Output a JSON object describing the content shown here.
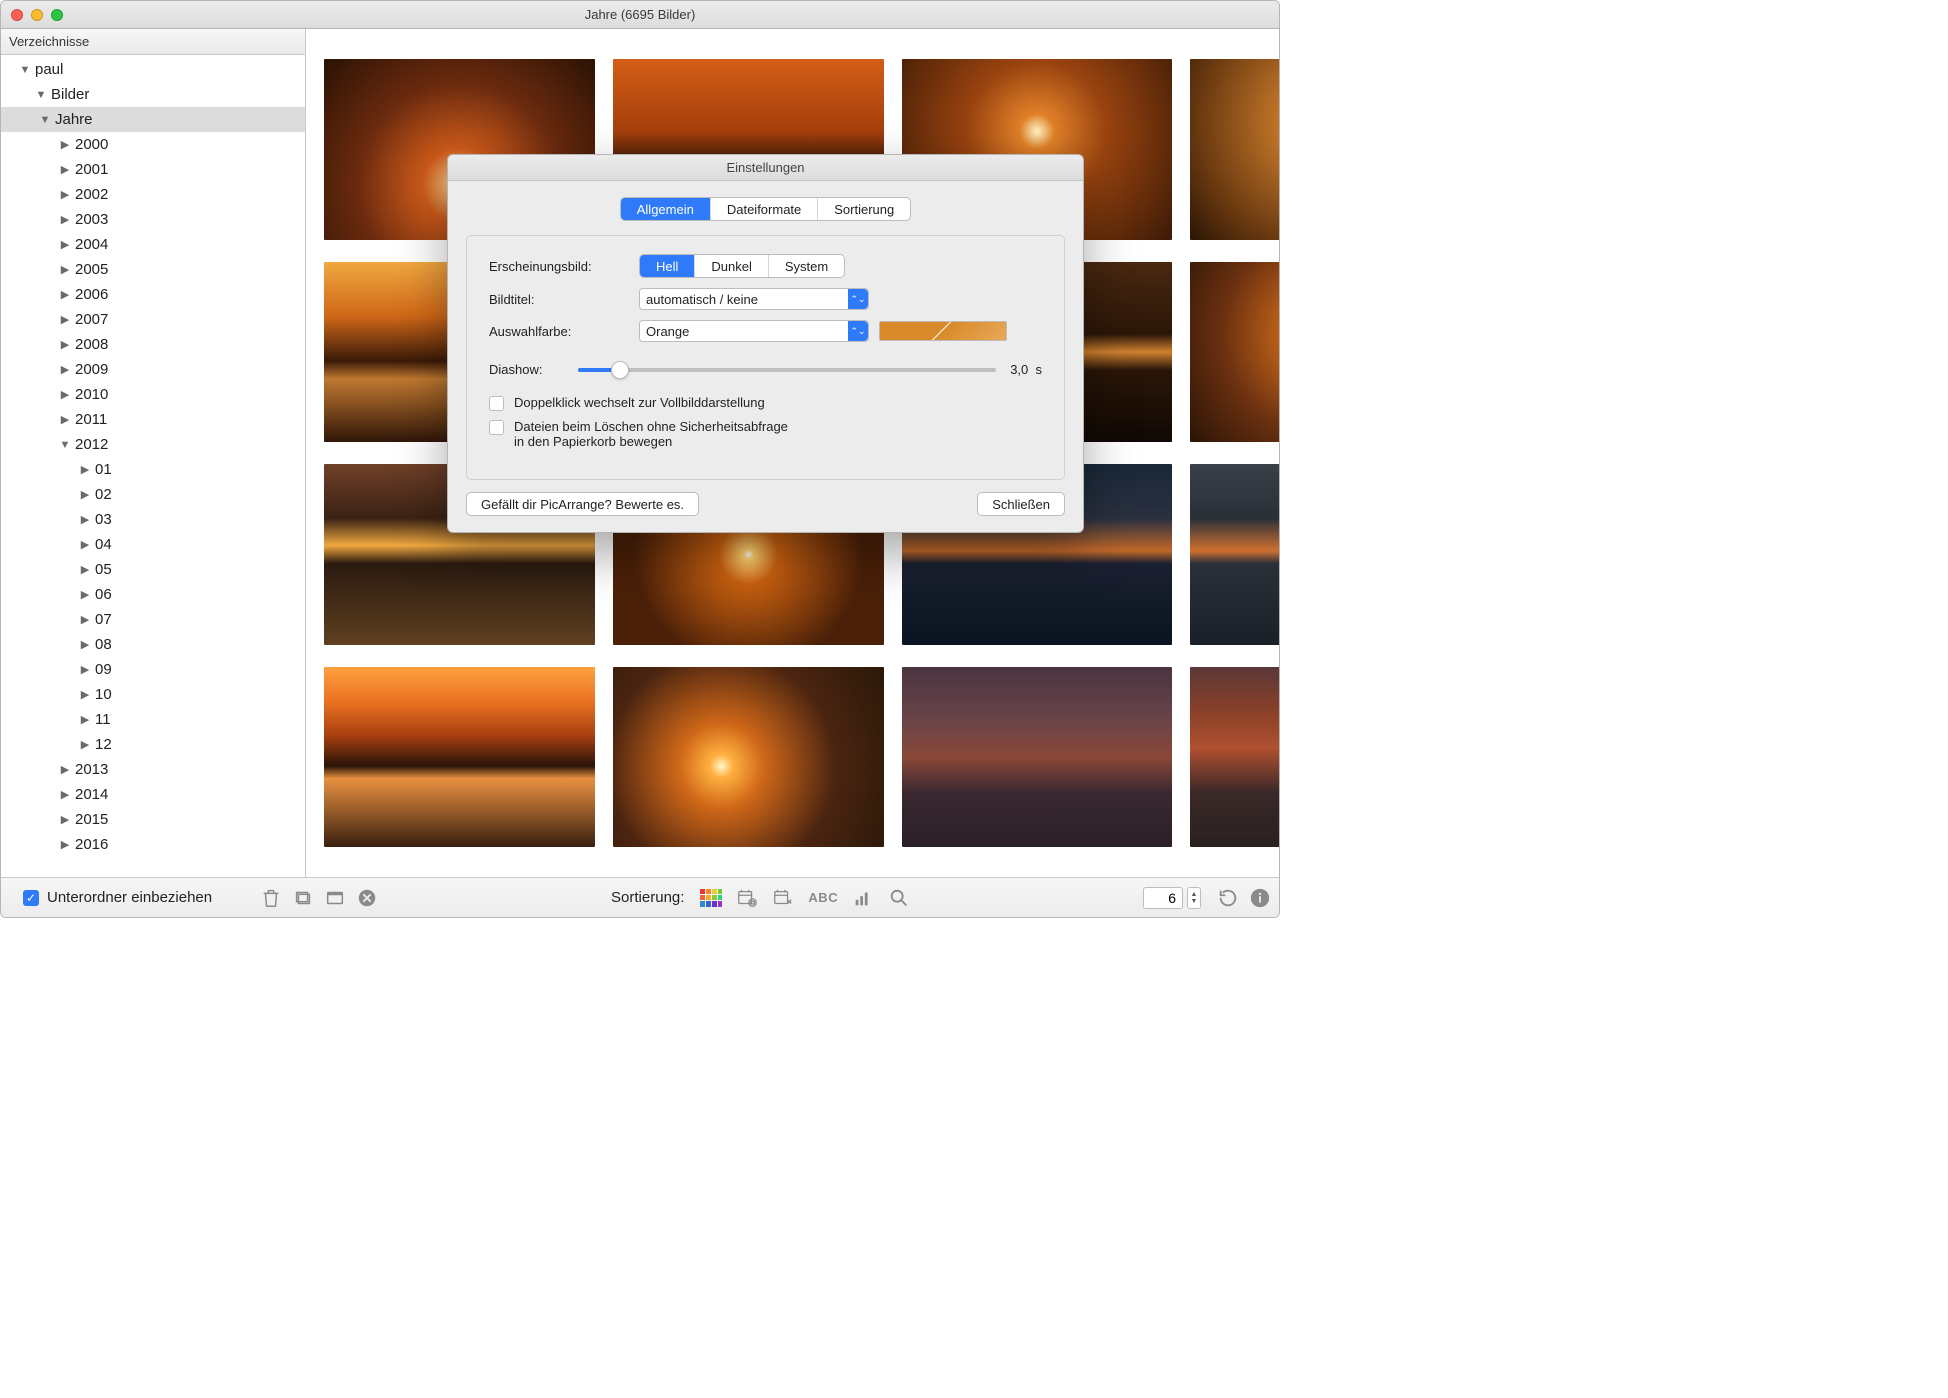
{
  "window": {
    "title": "Jahre (6695 Bilder)"
  },
  "sidebar": {
    "header": "Verzeichnisse",
    "root": "paul",
    "bilder": "Bilder",
    "jahre": "Jahre",
    "years": [
      "2000",
      "2001",
      "2002",
      "2003",
      "2004",
      "2005",
      "2006",
      "2007",
      "2008",
      "2009",
      "2010",
      "2011",
      "2012"
    ],
    "months": [
      "01",
      "02",
      "03",
      "04",
      "05",
      "06",
      "07",
      "08",
      "09",
      "10",
      "11",
      "12"
    ],
    "years_after": [
      "2013",
      "2014",
      "2015",
      "2016"
    ]
  },
  "bottombar": {
    "subfolders_label": "Unterordner einbeziehen",
    "subfolders_checked": true,
    "sort_label": "Sortierung:",
    "zoom_value": "6"
  },
  "dialog": {
    "title": "Einstellungen",
    "tabs": {
      "general": "Allgemein",
      "formats": "Dateiformate",
      "sorting": "Sortierung"
    },
    "appearance_label": "Erscheinungsbild:",
    "appearance": {
      "light": "Hell",
      "dark": "Dunkel",
      "system": "System"
    },
    "title_label": "Bildtitel:",
    "title_value": "automatisch / keine",
    "selcolor_label": "Auswahlfarbe:",
    "selcolor_value": "Orange",
    "slideshow_label": "Diashow:",
    "slideshow_value": "3,0",
    "slideshow_unit": "s",
    "cb1": "Doppelklick wechselt zur Vollbilddarstellung",
    "cb2a": "Dateien beim Löschen ohne Sicherheitsabfrage",
    "cb2b": "in den Papierkorb bewegen",
    "rate_btn": "Gefällt dir PicArrange? Bewerte es.",
    "close_btn": "Schließen"
  }
}
